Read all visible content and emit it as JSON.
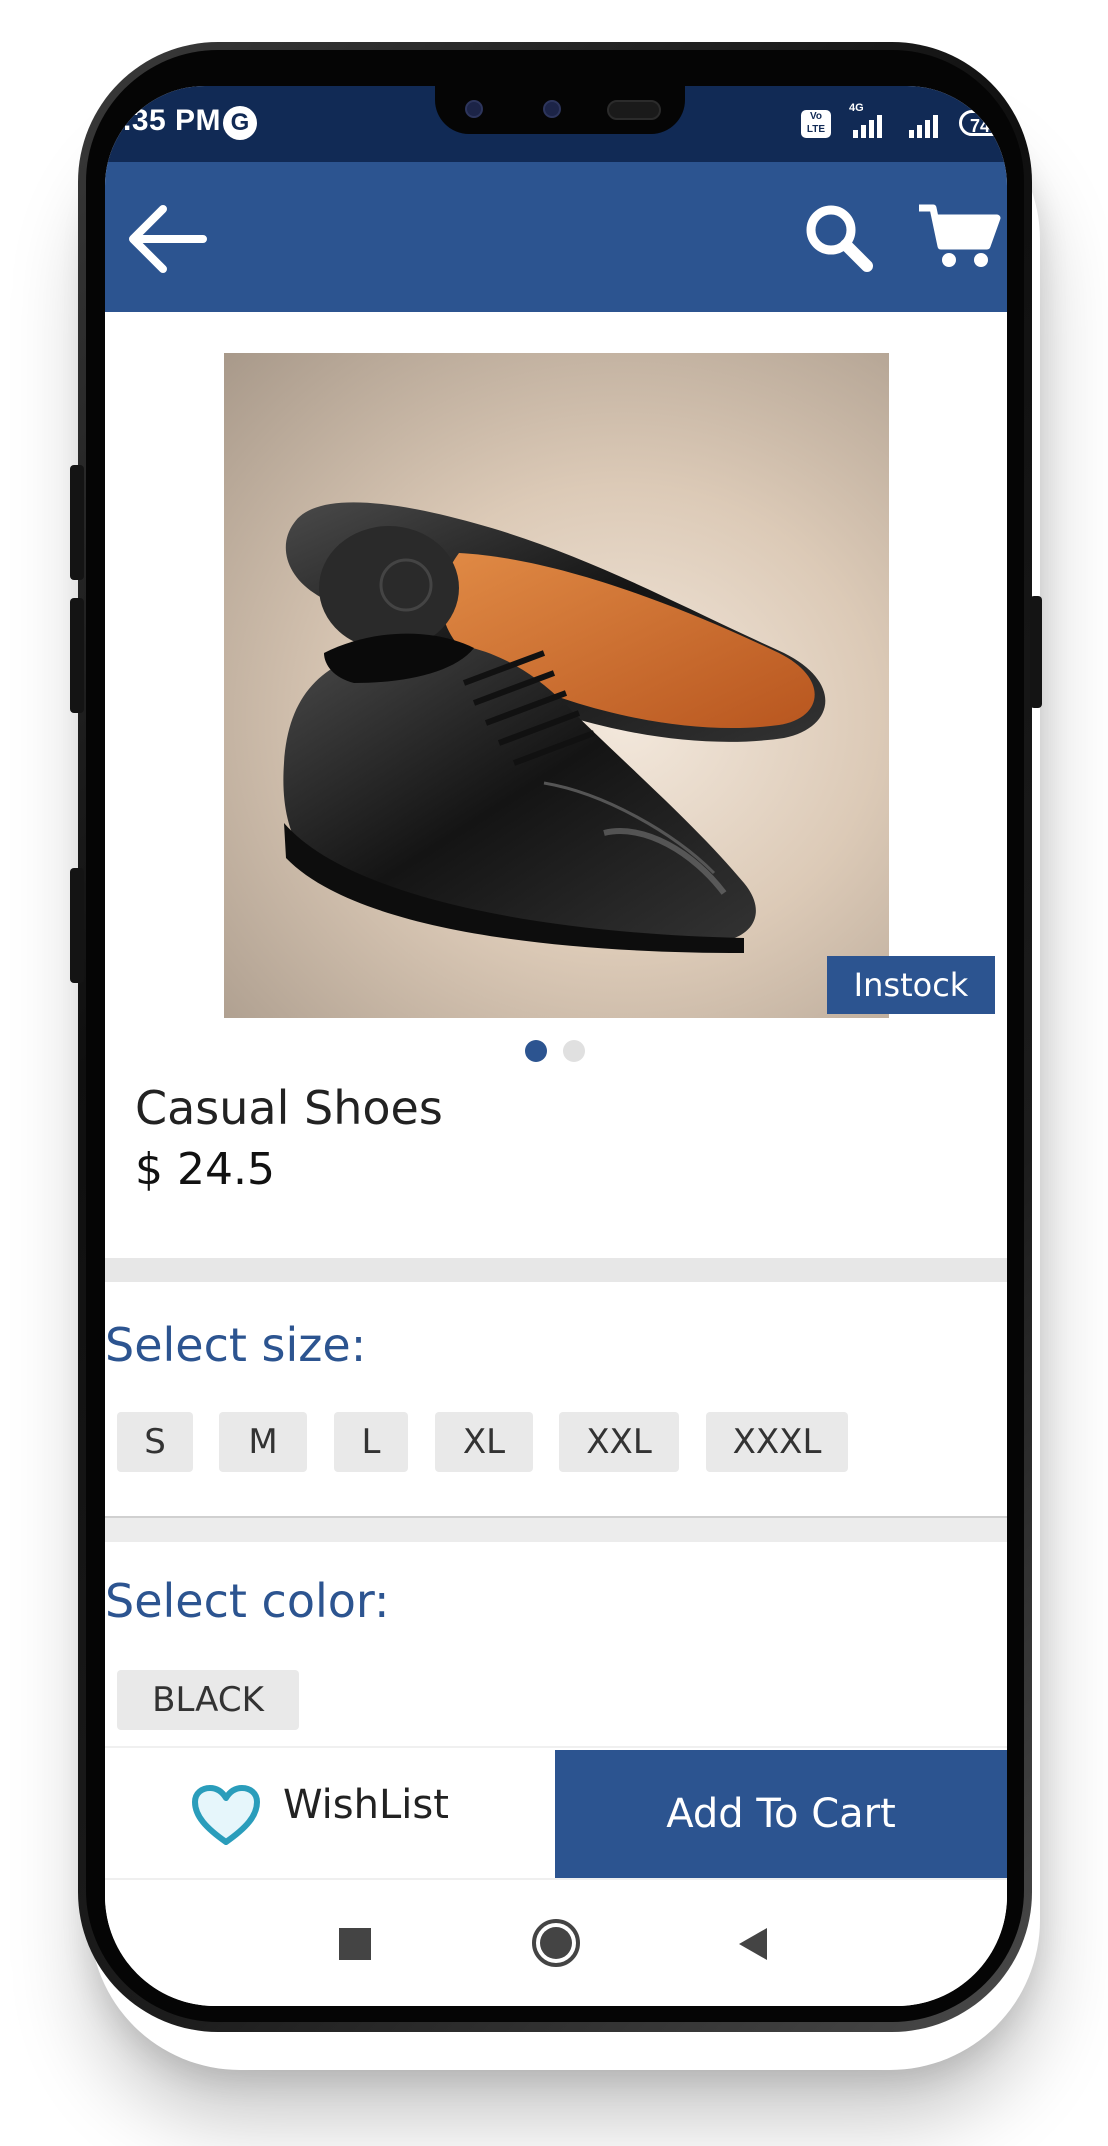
{
  "status_bar": {
    "time": ".35 PM",
    "google_badge": "G",
    "volte": "Vo LTE",
    "network": "4G",
    "battery": "74"
  },
  "icons": {
    "back": "arrow-left-icon",
    "search": "search-icon",
    "cart": "cart-icon",
    "wishlist": "heart-icon",
    "nav_recent": "square-icon",
    "nav_home": "circle-icon",
    "nav_back": "triangle-left-icon"
  },
  "product": {
    "name": "Casual Shoes",
    "price": "$ 24.5",
    "stock_badge": "Instock",
    "image_count": 2,
    "active_image": 1
  },
  "size_section": {
    "title": "Select size:",
    "options": [
      "S",
      "M",
      "L",
      "XL",
      "XXL",
      "XXXL"
    ]
  },
  "color_section": {
    "title": "Select color:",
    "options": [
      "BLACK"
    ]
  },
  "actions": {
    "wishlist_label": "WishList",
    "add_to_cart_label": "Add To Cart"
  },
  "colors": {
    "primary": "#2c5490",
    "status_bar": "#112a55",
    "chip_bg": "#e9e9e9",
    "heart_outline": "#2a9dbb",
    "dot_inactive": "#e0e0e0"
  }
}
